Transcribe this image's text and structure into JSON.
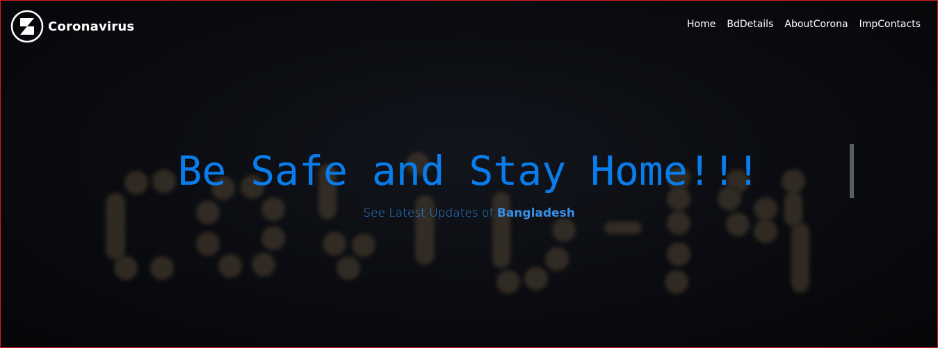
{
  "brand": {
    "name": "Coronavirus",
    "logo_icon": "triangle-hexagon-logo-icon"
  },
  "nav": {
    "items": [
      {
        "label": "Home"
      },
      {
        "label": "BdDetails"
      },
      {
        "label": "AboutCorona"
      },
      {
        "label": "ImpContacts"
      }
    ]
  },
  "hero": {
    "title": "Be Safe and Stay Home!!!",
    "subtitle_prefix": "See Latest Updates of",
    "subtitle_highlight": "Bangladesh",
    "background_text": "COVID-19"
  },
  "colors": {
    "title": "#0a7ded",
    "subtitle": "#2f80db",
    "nav_text": "#ffffff",
    "frame_border": "#d61f1f",
    "background": "#0b0d12"
  }
}
